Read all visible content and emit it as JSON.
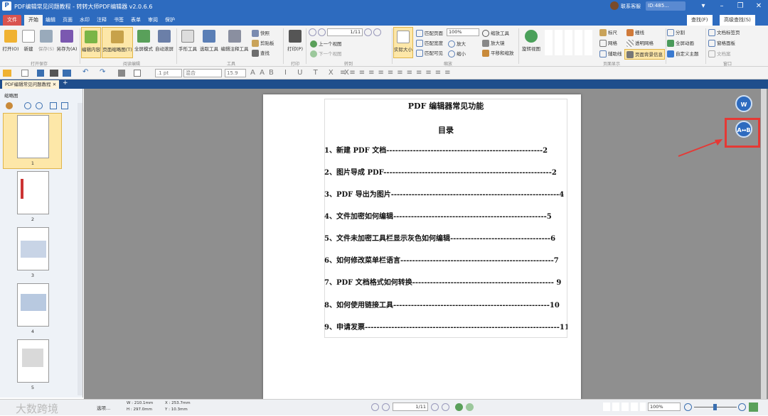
{
  "app": {
    "title": "PDF编辑常见问题教程 - 转转大师PDF编辑器 v2.0.6.6",
    "logo": "P",
    "support": "联系客服",
    "user": "ID:485..."
  },
  "menu": {
    "file": "文件",
    "tabs": [
      "开始",
      "编辑",
      "页面",
      "水印",
      "注释",
      "书签",
      "表单",
      "审阅",
      "保护"
    ],
    "search": "查找(F)",
    "adv_search": "高级查找(S)"
  },
  "ribbon": {
    "open": "打开(O)",
    "new": "新建",
    "save": "保存(S)",
    "saveas": "另存为(A)",
    "g_file": "打开保存",
    "edit_content": "编辑内容",
    "page_thumbs": "页面缩略图(T)",
    "fullscreen": "全屏模式",
    "auto_scroll": "自动滚屏",
    "g_read": "阅读编辑",
    "hand": "手形工具",
    "select_text": "选取工具",
    "edit_annot": "编辑注释工具",
    "snapshot": "快照",
    "clipboard": "剪贴板",
    "find": "查找",
    "g_tools": "工具",
    "print": "打印(P)",
    "g_print": "打印",
    "page_value": "1",
    "page_total": "11",
    "prev_view": "上一个视图",
    "next_view": "下一个视图",
    "g_nav": "转到",
    "actual": "实际大小",
    "fit_page": "匹配页面",
    "fit_width": "匹配宽度",
    "fit_visible": "匹配可见",
    "zoom_value": "100%",
    "zoom_in": "放大",
    "zoom_out": "缩小",
    "zoom_tool": "缩放工具",
    "magnifier": "放大镜",
    "pan_zoom": "平移和缩放",
    "g_zoom": "缩放",
    "rotate": "旋转视图",
    "ruler": "标尺",
    "grid": "网格",
    "guides": "辅助线",
    "lineweight": "细线",
    "transparent_grid": "透明网格",
    "page_bg": "页面背景信息",
    "g_display": "页面显示",
    "split": "分割",
    "fullscreen_anim": "全屏动画",
    "custom_theme": "自定义主题",
    "doc_tab": "文档标签页",
    "window_panel": "窗格面板",
    "file_list": "文档案",
    "g_window": "窗口"
  },
  "format": {
    "font_size": ".1 pt",
    "blend": "混合",
    "size2": "15.9"
  },
  "tab": {
    "doc": "PDF编辑常见问题教程"
  },
  "sidebar": {
    "title": "缩略图",
    "pages": [
      "1",
      "2",
      "3",
      "4",
      "5"
    ]
  },
  "document": {
    "title": "PDF 编辑器常见功能",
    "toc_heading": "目录",
    "toc": [
      {
        "text": "1、新建 PDF 文档-----------------------------------------------------2"
      },
      {
        "text": "2、图片导成 PDF---------------------------------------------------------2"
      },
      {
        "text": "3、PDF 导出为图片---------------------------------------------------------4"
      },
      {
        "text": "4、文件加密如何编辑----------------------------------------------------5"
      },
      {
        "text": "5、文件未加密工具栏显示灰色如何编辑----------------------------------6"
      },
      {
        "text": "6、如何修改菜单栏语言----------------------------------------------------7"
      },
      {
        "text": "7、PDF 文档格式如何转换------------------------------------------------ 9"
      },
      {
        "text": "8、如何使用链接工具-----------------------------------------------------10"
      },
      {
        "text": "9、申请发票------------------------------------------------------------------11"
      }
    ]
  },
  "floating": {
    "btn1": "W",
    "btn2": "A↔B"
  },
  "status": {
    "select": "选项...",
    "w": "W : 210.1mm",
    "h": "H : 297.0mm",
    "x": "X : 253.7mm",
    "y": "Y : 10.3mm",
    "page": "1",
    "total": "11",
    "zoom": "100%",
    "watermark": "大数跨境"
  },
  "colors": {
    "accent": "#2d6bbf",
    "highlight": "#e53935"
  }
}
